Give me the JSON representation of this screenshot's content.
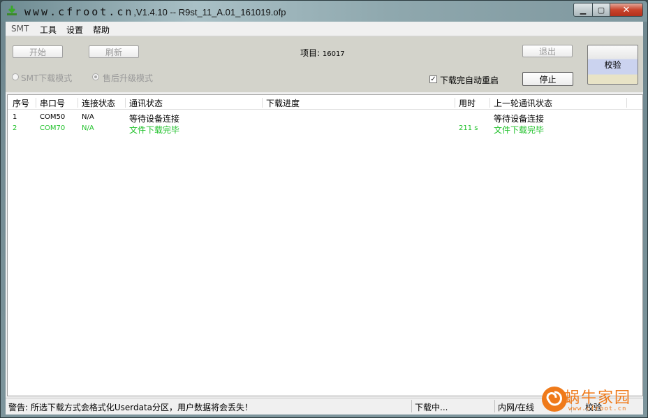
{
  "window": {
    "title_site": "www.cfroot.cn",
    "title_rest": ",V1.4.10 -- R9st_11_A.01_161019.ofp",
    "min_label": "▁",
    "max_label": "▢",
    "close_label": "✕"
  },
  "menu": {
    "items": [
      "SMT",
      "工具",
      "设置",
      "帮助"
    ]
  },
  "toolbar": {
    "start_label": "开始",
    "refresh_label": "刷新",
    "project_label": "项目: ",
    "project_value": "16017",
    "exit_label": "退出",
    "verify_label": "校验",
    "stop_label": "停止",
    "smt_mode_label": "SMT下载模式",
    "after_sale_label": "售后升级模式",
    "auto_restart_label": "下载完自动重启",
    "auto_restart_checked": true,
    "selected_mode": "售后升级模式"
  },
  "table": {
    "columns": [
      "序号",
      "串口号",
      "连接状态",
      "通讯状态",
      "下载进度",
      "用时",
      "上一轮通讯状态"
    ],
    "rows": [
      {
        "index": "1",
        "port": "COM50",
        "conn": "N/A",
        "comm": "等待设备连接",
        "progress": "",
        "time": "",
        "last": "等待设备连接",
        "color": "#000000"
      },
      {
        "index": "2",
        "port": "COM70",
        "conn": "N/A",
        "comm": "文件下载完毕",
        "progress": "",
        "time": "211 s",
        "last": "文件下载完毕",
        "color": "#22c22c"
      }
    ]
  },
  "status": {
    "warning": "警告: 所选下载方式会格式化Userdata分区，用户数据将会丢失！",
    "download": "下载中...",
    "network": "内网/在线",
    "verify": "校验"
  },
  "watermark": {
    "text": "蜗牛家园",
    "sub": "www.cfroot.cn"
  },
  "colors": {
    "accent_green": "#22c22c",
    "watermark_orange": "#ef7a1a"
  }
}
